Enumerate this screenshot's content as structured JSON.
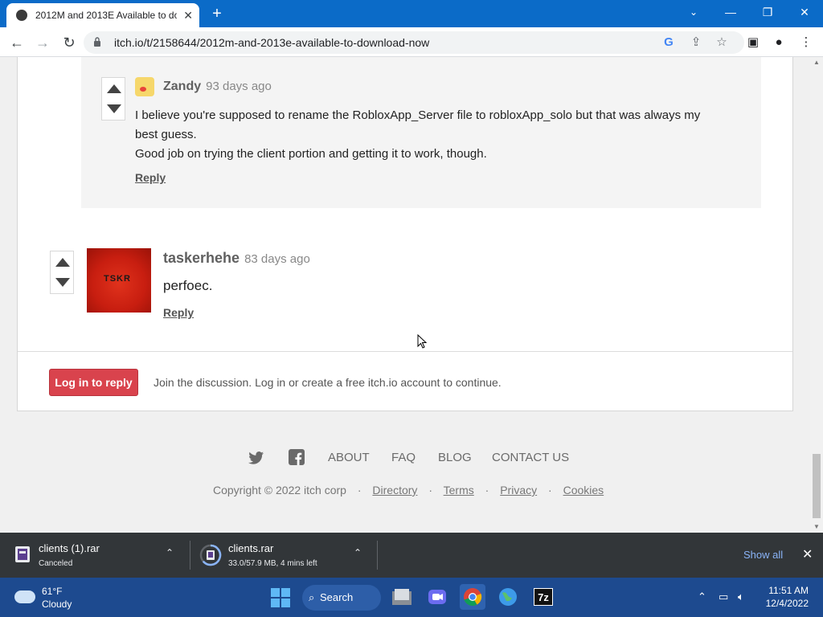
{
  "browser": {
    "tab_title": "2012M and 2013E Available to do",
    "url": "itch.io/t/2158644/2012m-and-2013e-available-to-download-now"
  },
  "comments": {
    "reply": {
      "author": "Zandy",
      "ago": "93 days ago",
      "line1": "I believe you're supposed to rename the RobloxApp_Server file to robloxApp_solo but that was always my",
      "line2": "best guess.",
      "line3": "Good job on trying the client portion and getting it to work, though.",
      "reply_label": "Reply"
    },
    "main": {
      "author": "taskerhehe",
      "ago": "83 days ago",
      "text": "perfoec.",
      "avatar_text": "TSKR",
      "reply_label": "Reply"
    }
  },
  "login": {
    "button": "Log in to reply",
    "message": "Join the discussion. Log in or create a free itch.io account to continue."
  },
  "footer": {
    "links": [
      "ABOUT",
      "FAQ",
      "BLOG",
      "CONTACT US"
    ],
    "copyright": "Copyright © 2022 itch corp",
    "sublinks": [
      "Directory",
      "Terms",
      "Privacy",
      "Cookies"
    ],
    "sep": "·"
  },
  "downloads": [
    {
      "name": "clients (1).rar",
      "status": "Canceled"
    },
    {
      "name": "clients.rar",
      "status": "33.0/57.9 MB, 4 mins left"
    }
  ],
  "shelf": {
    "show_all": "Show all"
  },
  "taskbar": {
    "temp": "61°F",
    "condition": "Cloudy",
    "search": "Search",
    "time": "11:51 AM",
    "date": "12/4/2022"
  }
}
